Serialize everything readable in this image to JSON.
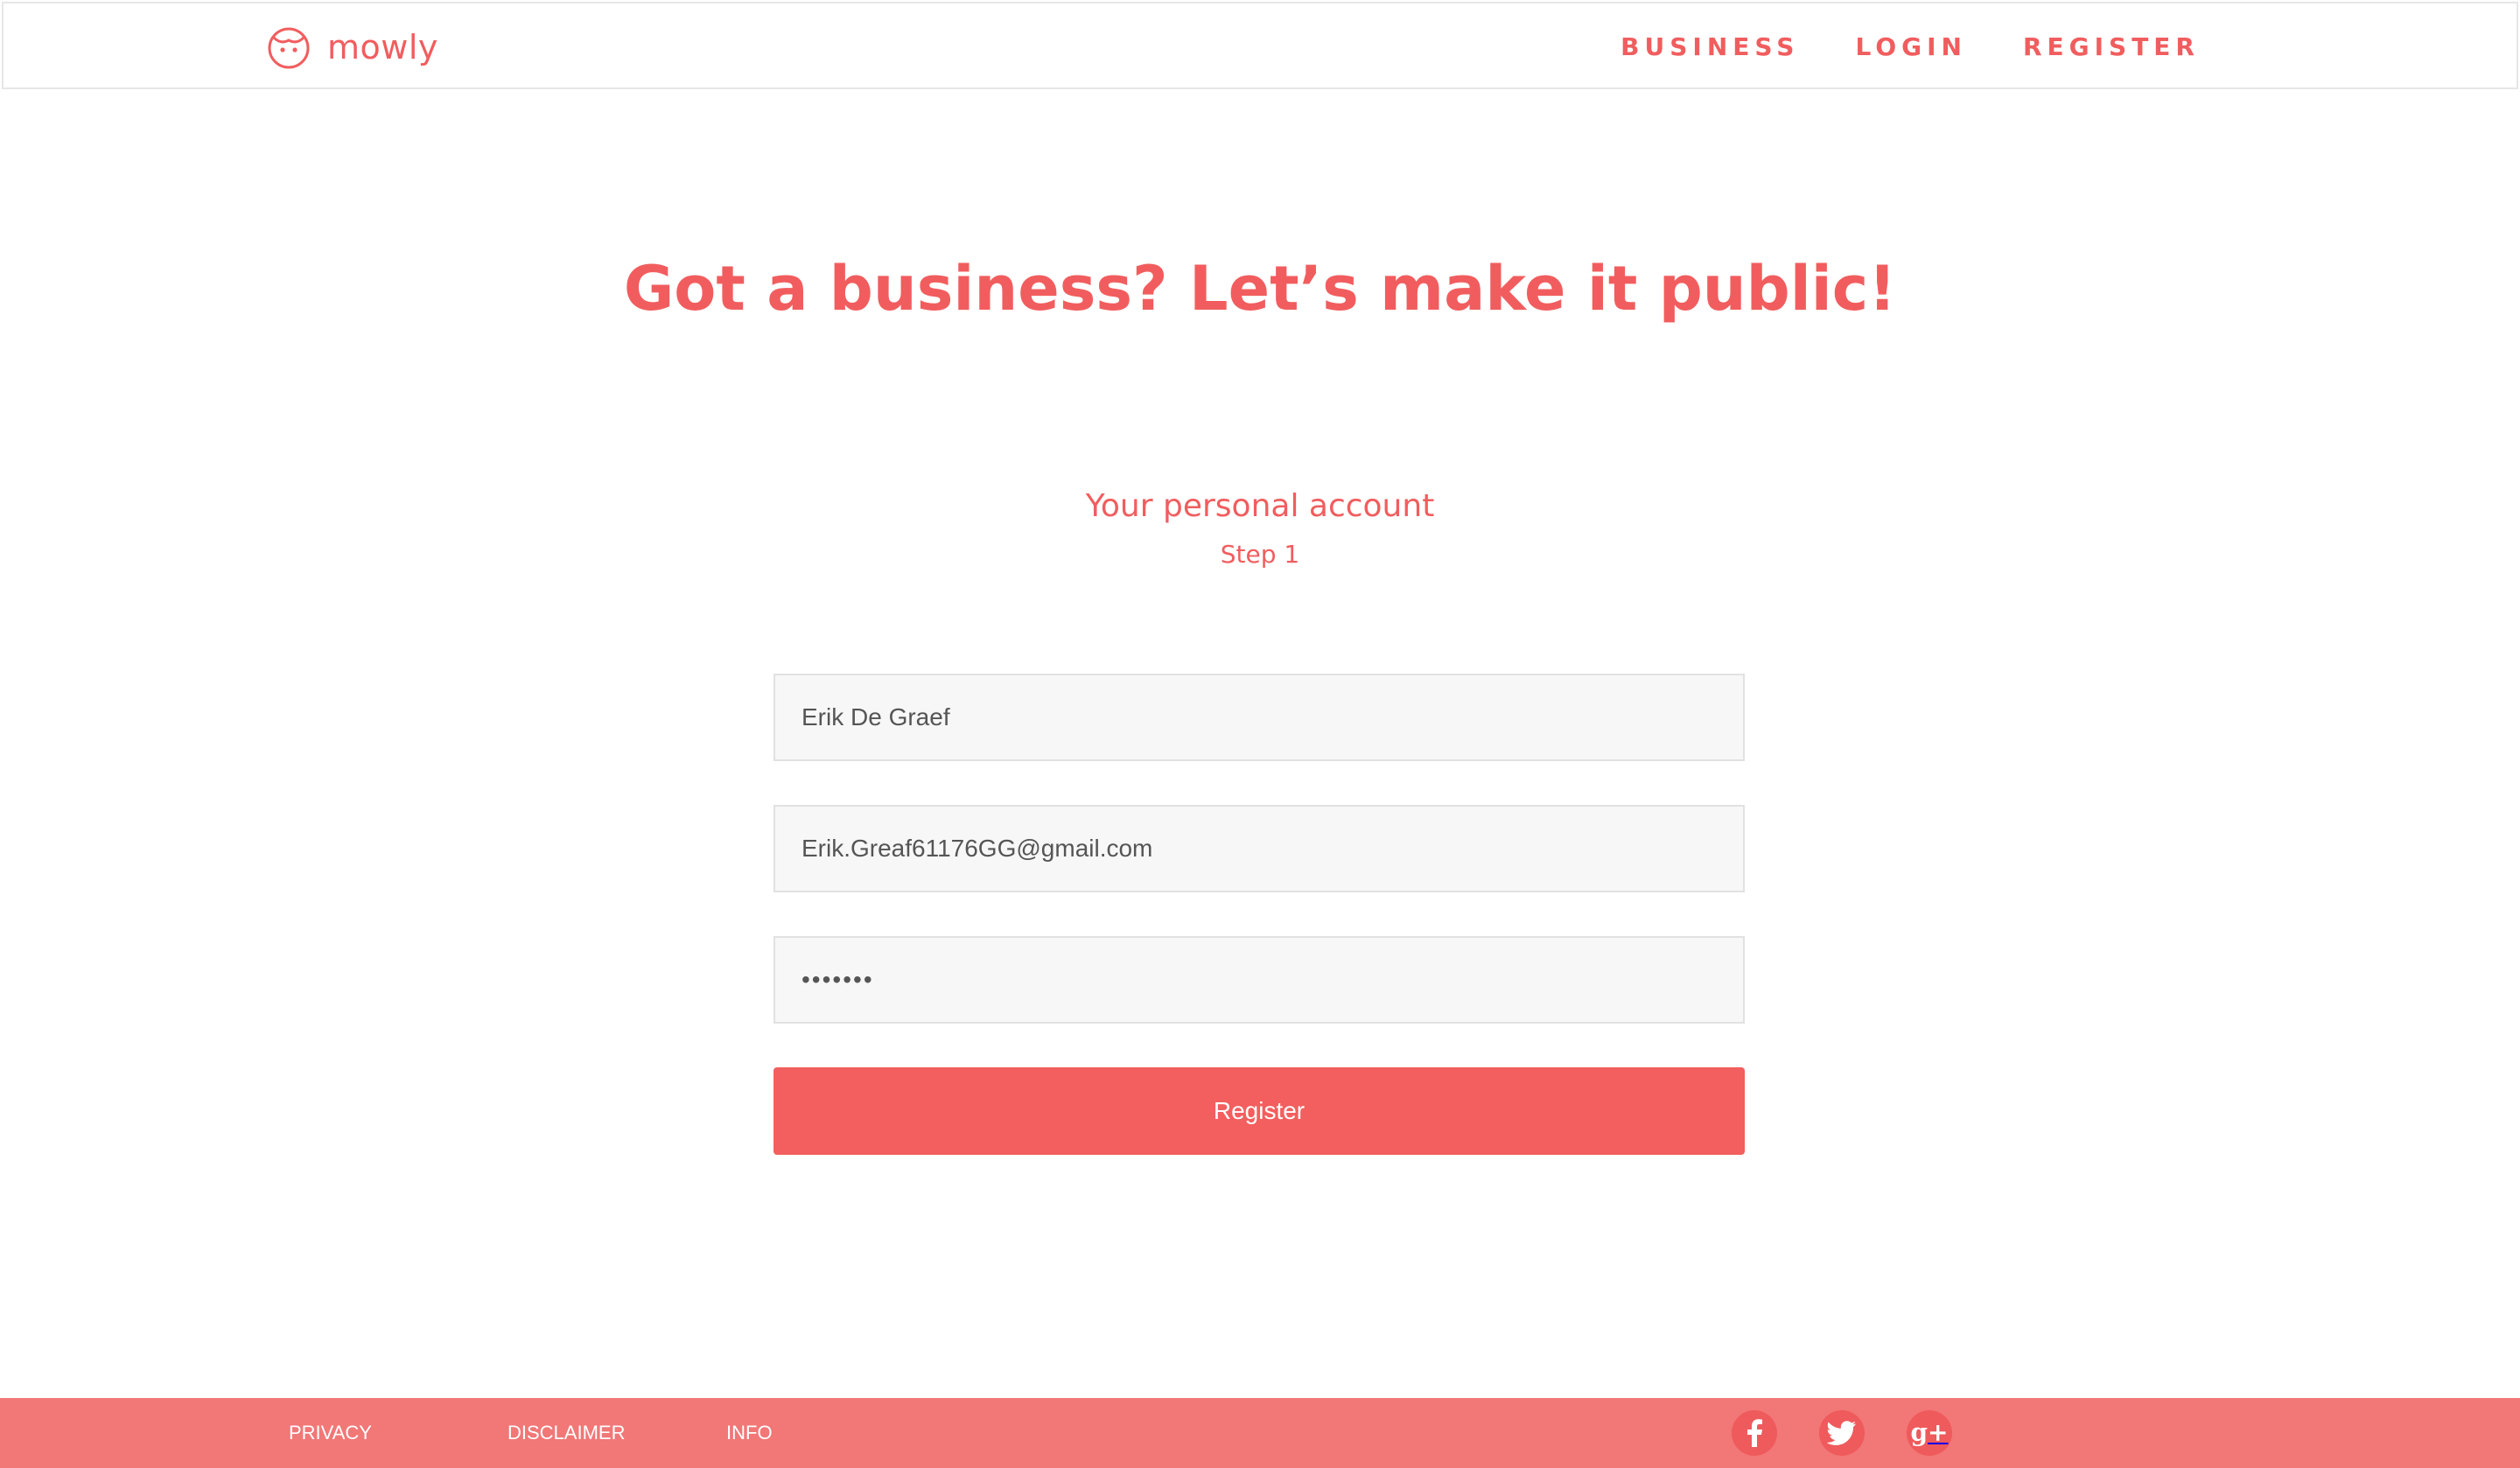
{
  "header": {
    "brand_name": "mowly",
    "nav": {
      "business": "BUSINESS",
      "login": "LOGIN",
      "register": "REGISTER"
    }
  },
  "hero": {
    "title": "Got a business? Let’s make it public!"
  },
  "form": {
    "heading": "Your personal account",
    "step": "Step 1",
    "name_value": "Erik De Graef",
    "email_value": "Erik.Greaf61176GG@gmail.com",
    "password_value": "•••••••",
    "submit_label": "Register"
  },
  "footer": {
    "links": {
      "privacy": "PRIVACY",
      "disclaimer": "DISCLAIMER",
      "info": "INFO"
    },
    "social": {
      "facebook_icon": "facebook-icon",
      "twitter_icon": "twitter-icon",
      "gplus_icon": "google-plus-icon",
      "gplus_glyph": "g+"
    }
  },
  "colors": {
    "brand": "#f15d5e",
    "button": "#f35e5e",
    "footer_bg": "#f27777",
    "input_bg": "#f7f7f7"
  }
}
